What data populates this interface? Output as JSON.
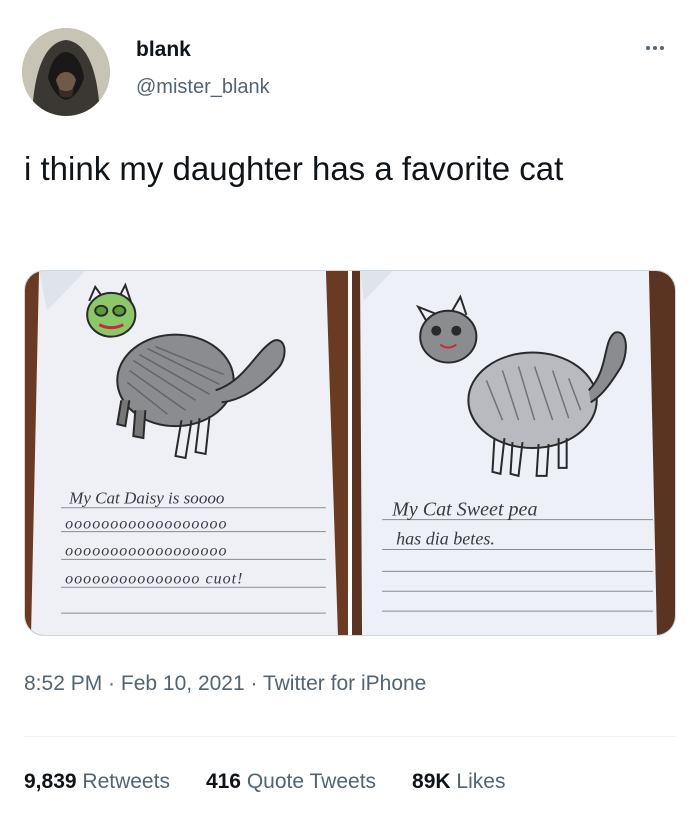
{
  "author": {
    "name": "blank",
    "handle": "@mister_blank"
  },
  "tweet": {
    "text": "i think my daughter has a favorite cat"
  },
  "media": {
    "left_caption_lines": [
      "My Cat Daisy is soooo",
      "oooooooooooooooooo",
      "oooooooooooooooooo",
      "ooooooooooooooo cuot!"
    ],
    "right_caption_lines": [
      "My Cat Sweet pea",
      "has dia betes."
    ]
  },
  "meta": {
    "time": "8:52 PM",
    "separator": " · ",
    "date": "Feb 10, 2021",
    "source": "Twitter for iPhone"
  },
  "stats": {
    "retweets_count": "9,839",
    "retweets_label": "Retweets",
    "quotes_count": "416",
    "quotes_label": "Quote Tweets",
    "likes_count": "89K",
    "likes_label": "Likes"
  },
  "icons": {
    "more": "more-horizontal-icon"
  }
}
